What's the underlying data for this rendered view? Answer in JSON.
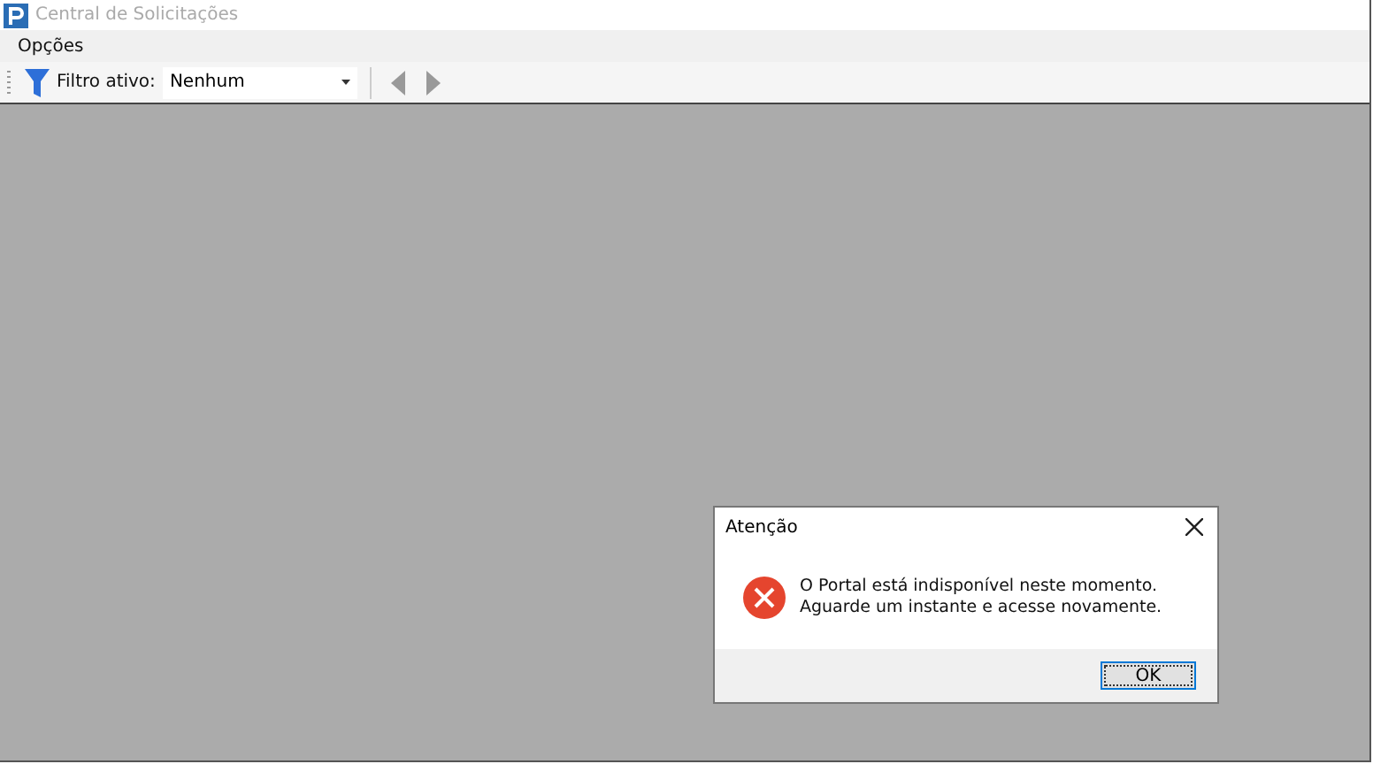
{
  "window": {
    "title": "Central de Solicitações",
    "active": false
  },
  "menu": [
    {
      "label": "Opções"
    }
  ],
  "toolbar": {
    "filter_label": "Filtro ativo:",
    "filter_value": "Nenhum",
    "prev_disabled": true,
    "next_disabled": true
  },
  "dialog": {
    "title": "Atenção",
    "kind": "error",
    "message": "O Portal está indisponível neste momento. Aguarde um instante e acesse novamente.",
    "buttons": [
      "OK"
    ]
  }
}
